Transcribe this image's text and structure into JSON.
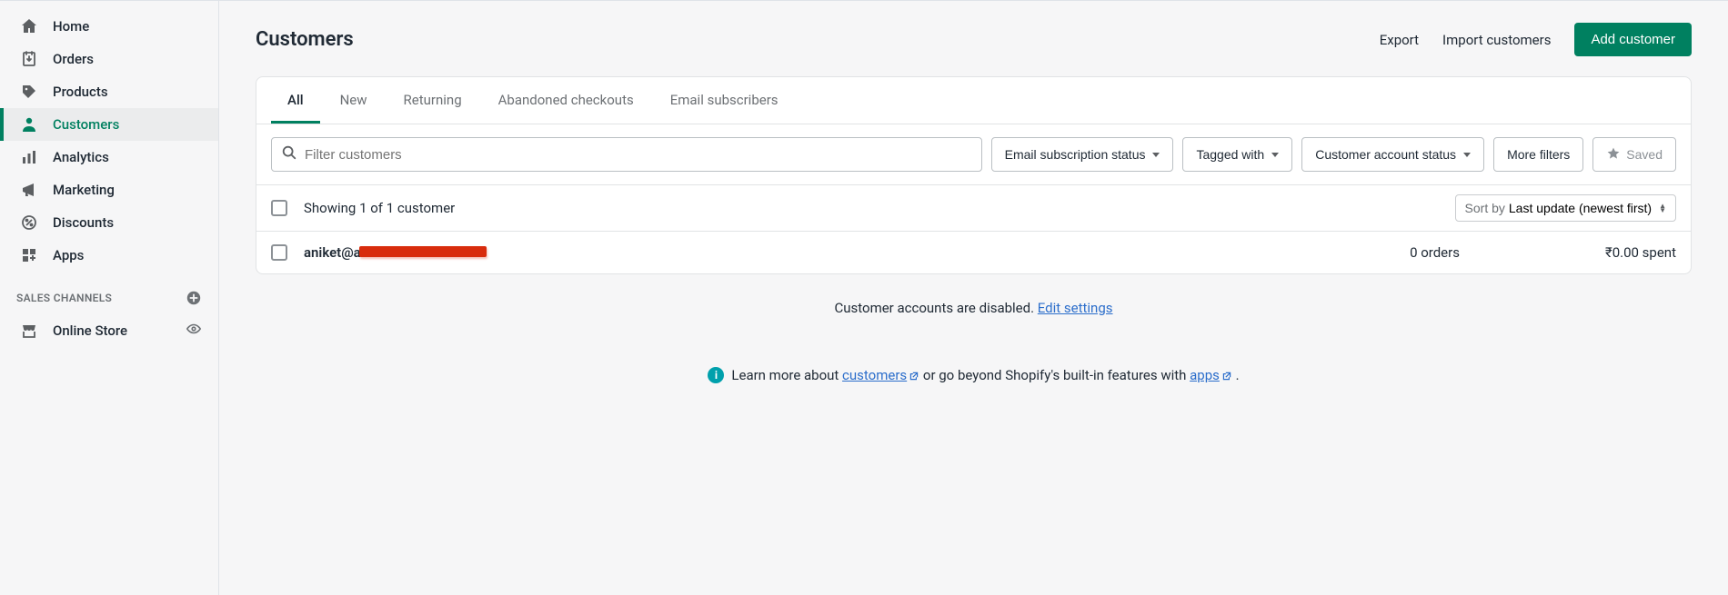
{
  "sidebar": {
    "items": [
      {
        "label": "Home",
        "icon": "home-icon"
      },
      {
        "label": "Orders",
        "icon": "orders-icon"
      },
      {
        "label": "Products",
        "icon": "products-icon"
      },
      {
        "label": "Customers",
        "icon": "customers-icon",
        "active": true
      },
      {
        "label": "Analytics",
        "icon": "analytics-icon"
      },
      {
        "label": "Marketing",
        "icon": "marketing-icon"
      },
      {
        "label": "Discounts",
        "icon": "discounts-icon"
      },
      {
        "label": "Apps",
        "icon": "apps-icon"
      }
    ],
    "channels_header": "SALES CHANNELS",
    "channels": [
      {
        "label": "Online Store",
        "icon": "store-icon"
      }
    ]
  },
  "page": {
    "title": "Customers",
    "actions": {
      "export": "Export",
      "import": "Import customers",
      "add": "Add customer"
    }
  },
  "tabs": [
    "All",
    "New",
    "Returning",
    "Abandoned checkouts",
    "Email subscribers"
  ],
  "active_tab": "All",
  "filters": {
    "search_placeholder": "Filter customers",
    "email_status": "Email subscription status",
    "tagged": "Tagged with",
    "account_status": "Customer account status",
    "more": "More filters",
    "saved": "Saved"
  },
  "count_text": "Showing 1 of 1 customer",
  "sort": {
    "prefix": "Sort by",
    "value": "Last update (newest first)"
  },
  "customers": [
    {
      "name_prefix": "aniket@a",
      "orders": "0 orders",
      "spent": "₹0.00 spent"
    }
  ],
  "notice": {
    "disabled_text": "Customer accounts are disabled. ",
    "edit_link": "Edit settings"
  },
  "learn": {
    "prefix": "Learn more about ",
    "customers_link": "customers",
    "middle": "  or go beyond Shopify's built-in features with ",
    "apps_link": "apps",
    "suffix": " ."
  }
}
